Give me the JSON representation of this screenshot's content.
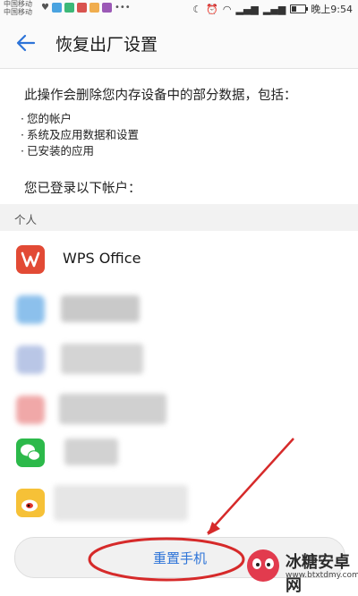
{
  "status_bar": {
    "carrier_1": "中国移动",
    "carrier_2": "中国移动",
    "time": "晚上9:54"
  },
  "header": {
    "title": "恢复出厂设置"
  },
  "content": {
    "intro": "此操作会删除您内存设备中的部分数据，包括：",
    "bullets": [
      "您的帐户",
      "系统及应用数据和设置",
      "已安装的应用"
    ],
    "logged_in_label": "您已登录以下帐户：",
    "section_label": "个人",
    "accounts": [
      {
        "label": "WPS Office"
      }
    ]
  },
  "footer": {
    "reset_label": "重置手机"
  },
  "watermark": {
    "title": "冰糖安卓网",
    "url": "www.btxtdmy.com"
  },
  "colors": {
    "accent": "#2d74d8",
    "annotation": "#d62a2a"
  }
}
